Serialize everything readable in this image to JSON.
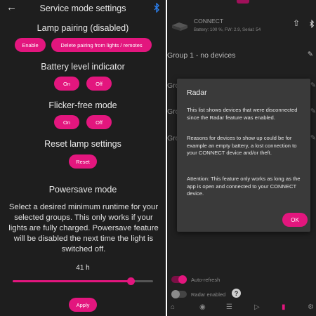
{
  "left": {
    "title": "Service mode settings",
    "back_icon": "arrow-left-icon",
    "bluetooth_icon": "bluetooth-icon",
    "accent": "#e3167e",
    "lamp_pairing": {
      "title": "Lamp pairing (disabled)",
      "enable": "Enable",
      "delete": "Delete pairing from lights / remotes"
    },
    "battery": {
      "title": "Battery level indicator",
      "on": "On",
      "off": "Off"
    },
    "flicker": {
      "title": "Flicker-free mode",
      "on": "On",
      "off": "Off"
    },
    "reset": {
      "title": "Reset lamp settings",
      "button": "Reset"
    },
    "powersave": {
      "title": "Powersave mode",
      "description": "Select a desired minimum runtime for your selected groups. This only works if your lights are fully charged. Powersave feature will be disabled the next time the light is switched off.",
      "runtime": "41 h",
      "slider_fraction": 0.84,
      "apply": "Apply"
    }
  },
  "right": {
    "device": {
      "name": "CONNECT",
      "info": "Battery: 100 %,  FW: 2.9,  Serial: 54",
      "icon": "device-icon",
      "upload_icon": "upload-icon",
      "bluetooth_icon": "bluetooth-icon"
    },
    "group1": "Group 1 - no devices",
    "group_partials": [
      "Gro",
      "Gro",
      "Gro"
    ],
    "toggles": {
      "auto_refresh": "Auto-refresh",
      "radar_enabled": "Radar enabled",
      "auto_refresh_on": true,
      "radar_enabled_on": false
    },
    "dialog": {
      "title": "Radar",
      "p1": "This list shows devices that were disconnected since the Radar feature was enabled.",
      "p2": "Reasons for devices to show up could be for example an empty battery, a lost connection to your CONNECT device and/or theft.",
      "p3": "Attention: This feature only works as long as the app is open and connected to your CONNECT device.",
      "ok": "OK"
    },
    "nav_icons": [
      "home-icon",
      "palette-icon",
      "list-icon",
      "play-icon",
      "flashlight-icon",
      "settings-icon"
    ]
  }
}
